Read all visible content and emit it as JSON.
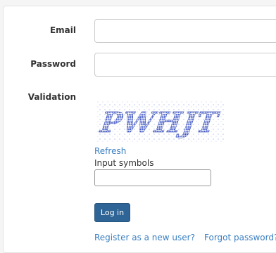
{
  "form": {
    "email_label": "Email",
    "email_value": "",
    "password_label": "Password",
    "password_value": "",
    "validation_label": "Validation",
    "captcha_text": "PWHJT",
    "refresh_label": "Refresh",
    "input_symbols_label": "Input symbols",
    "symbols_value": "",
    "login_button": "Log in",
    "register_link": "Register as a new user?",
    "forgot_link": "Forgot password?"
  },
  "colors": {
    "button": "#2f6596",
    "link": "#3a7fc1",
    "captcha_text": "#2a3fb0"
  }
}
